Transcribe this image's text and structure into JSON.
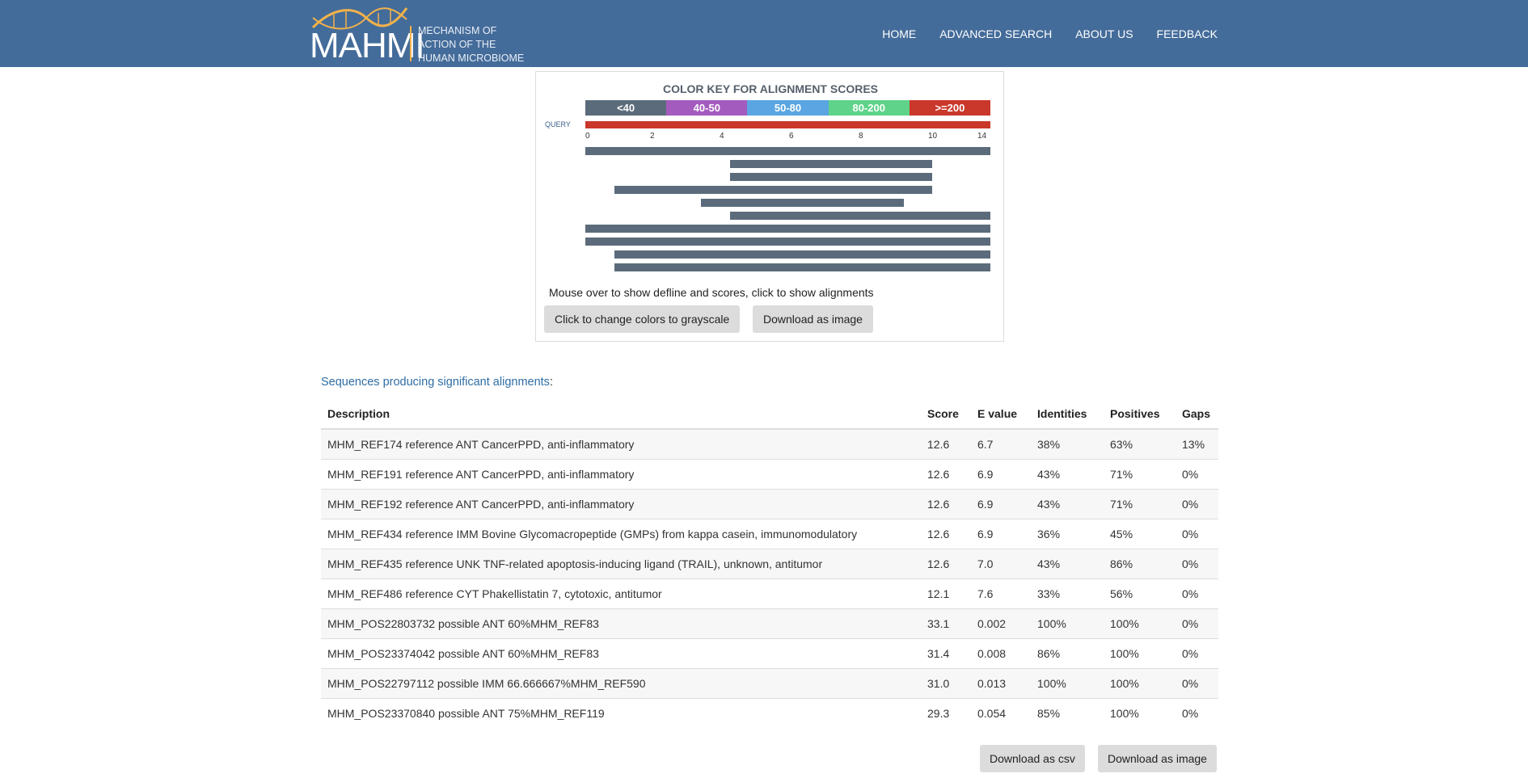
{
  "header": {
    "logo_text": "MAHMI",
    "tagline": [
      "MECHANISM OF",
      "ACTION OF THE",
      "HUMAN MICROBIOME"
    ],
    "nav": [
      "HOME",
      "ADVANCED SEARCH",
      "ABOUT US",
      "FEEDBACK"
    ],
    "bar_color": "#446c9a"
  },
  "graphic": {
    "title": "COLOR KEY FOR ALIGNMENT SCORES",
    "key": [
      {
        "label": "<40",
        "color": "#5b6b7b"
      },
      {
        "label": "40-50",
        "color": "#a45bbe"
      },
      {
        "label": "50-80",
        "color": "#5aa5e2"
      },
      {
        "label": "80-200",
        "color": "#5ed389"
      },
      {
        "label": ">=200",
        "color": "#c9382a"
      }
    ],
    "query_label": "QUERY",
    "query_color": "#c9382a",
    "axis_ticks": [
      "0",
      "2",
      "4",
      "6",
      "8",
      "10",
      "14"
    ],
    "axis_max": 14,
    "hits": [
      {
        "start": 0,
        "end": 14
      },
      {
        "start": 5,
        "end": 12
      },
      {
        "start": 5,
        "end": 12
      },
      {
        "start": 1,
        "end": 12
      },
      {
        "start": 4,
        "end": 11
      },
      {
        "start": 5,
        "end": 14
      },
      {
        "start": 0,
        "end": 14
      },
      {
        "start": 0,
        "end": 14
      },
      {
        "start": 1,
        "end": 14
      },
      {
        "start": 1,
        "end": 14
      }
    ],
    "hint": "Mouse over to show defline and scores, click to show alignments",
    "grayscale_button": "Click to change colors to grayscale",
    "download_image_button": "Download as image"
  },
  "results": {
    "title": "Sequences producing significant alignments",
    "title_suffix": ":",
    "columns": [
      "Description",
      "Score",
      "E value",
      "Identities",
      "Positives",
      "Gaps"
    ],
    "rows": [
      [
        "MHM_REF174 reference ANT CancerPPD, anti-inflammatory",
        "12.6",
        "6.7",
        "38%",
        "63%",
        "13%"
      ],
      [
        "MHM_REF191 reference ANT CancerPPD, anti-inflammatory",
        "12.6",
        "6.9",
        "43%",
        "71%",
        "0%"
      ],
      [
        "MHM_REF192 reference ANT CancerPPD, anti-inflammatory",
        "12.6",
        "6.9",
        "43%",
        "71%",
        "0%"
      ],
      [
        "MHM_REF434 reference IMM Bovine Glycomacropeptide (GMPs) from kappa casein, immunomodulatory",
        "12.6",
        "6.9",
        "36%",
        "45%",
        "0%"
      ],
      [
        "MHM_REF435 reference UNK TNF-related apoptosis-inducing ligand (TRAIL), unknown, antitumor",
        "12.6",
        "7.0",
        "43%",
        "86%",
        "0%"
      ],
      [
        "MHM_REF486 reference CYT Phakellistatin 7, cytotoxic, antitumor",
        "12.1",
        "7.6",
        "33%",
        "56%",
        "0%"
      ],
      [
        "MHM_POS22803732 possible ANT 60%MHM_REF83",
        "33.1",
        "0.002",
        "100%",
        "100%",
        "0%"
      ],
      [
        "MHM_POS23374042 possible ANT 60%MHM_REF83",
        "31.4",
        "0.008",
        "86%",
        "100%",
        "0%"
      ],
      [
        "MHM_POS22797112 possible IMM 66.666667%MHM_REF590",
        "31.0",
        "0.013",
        "100%",
        "100%",
        "0%"
      ],
      [
        "MHM_POS23370840 possible ANT 75%MHM_REF119",
        "29.3",
        "0.054",
        "85%",
        "100%",
        "0%"
      ]
    ],
    "download_csv_button": "Download as csv",
    "download_image_button": "Download as image"
  }
}
